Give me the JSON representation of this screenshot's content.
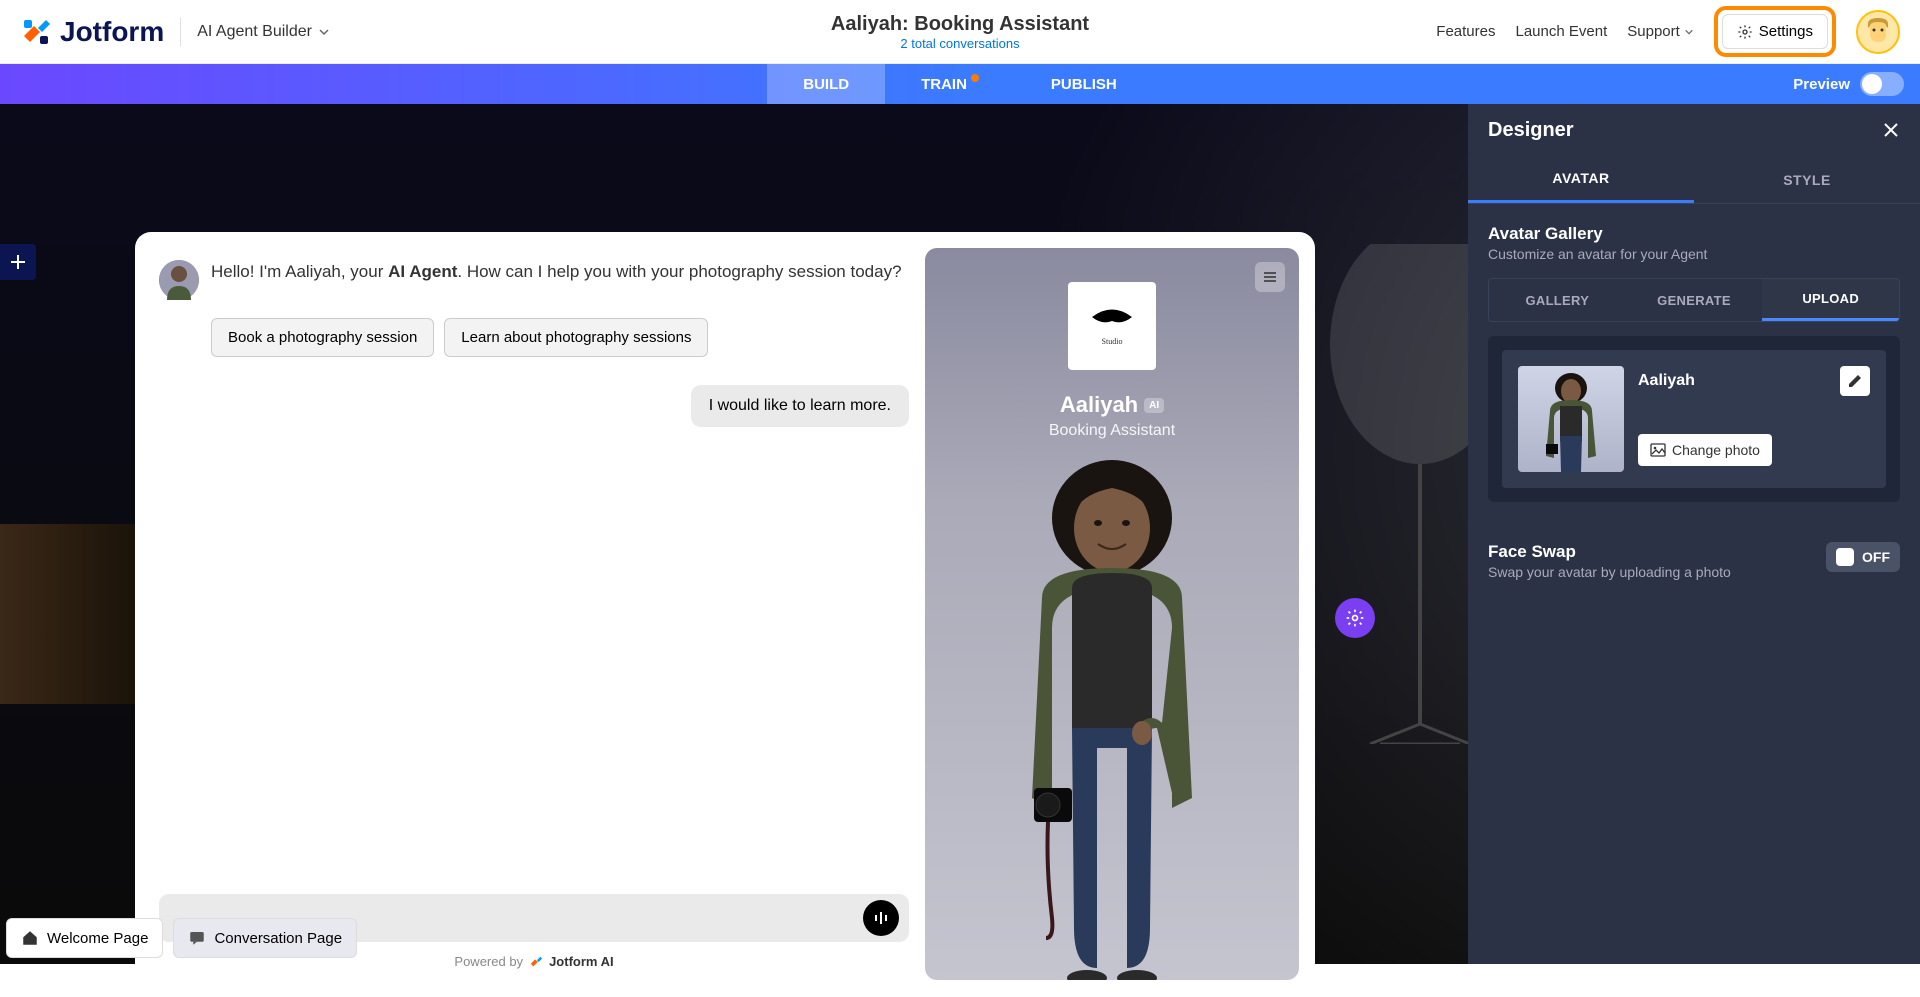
{
  "header": {
    "logo": "Jotform",
    "ai_builder": "AI Agent Builder",
    "title": "Aaliyah: Booking Assistant",
    "subtitle": "2 total conversations",
    "links": {
      "features": "Features",
      "launch": "Launch Event",
      "support": "Support"
    },
    "settings": "Settings"
  },
  "tabs": {
    "build": "BUILD",
    "train": "TRAIN",
    "publish": "PUBLISH",
    "preview": "Preview"
  },
  "chat": {
    "greeting_pre": "Hello! I'm Aaliyah, your ",
    "greeting_bold": "AI Agent",
    "greeting_post": ". How can I help you with your photography session today?",
    "chips": {
      "book": "Book a photography session",
      "learn": "Learn about photography sessions"
    },
    "user_msg": "I would like to learn more.",
    "powered_pre": "Powered by",
    "powered_brand": "Jotform AI"
  },
  "phone": {
    "name": "Aaliyah",
    "ai_badge": "AI",
    "subtitle": "Booking Assistant"
  },
  "designer": {
    "title": "Designer",
    "tabs": {
      "avatar": "AVATAR",
      "style": "STYLE"
    },
    "gallery_title": "Avatar Gallery",
    "gallery_sub": "Customize an avatar for your Agent",
    "subtabs": {
      "gallery": "GALLERY",
      "generate": "GENERATE",
      "upload": "UPLOAD"
    },
    "avatar_name": "Aaliyah",
    "change_photo": "Change photo",
    "face_swap_title": "Face Swap",
    "face_swap_sub": "Swap your avatar by uploading a photo",
    "off": "OFF"
  },
  "bottom": {
    "welcome": "Welcome Page",
    "conversation": "Conversation Page"
  }
}
